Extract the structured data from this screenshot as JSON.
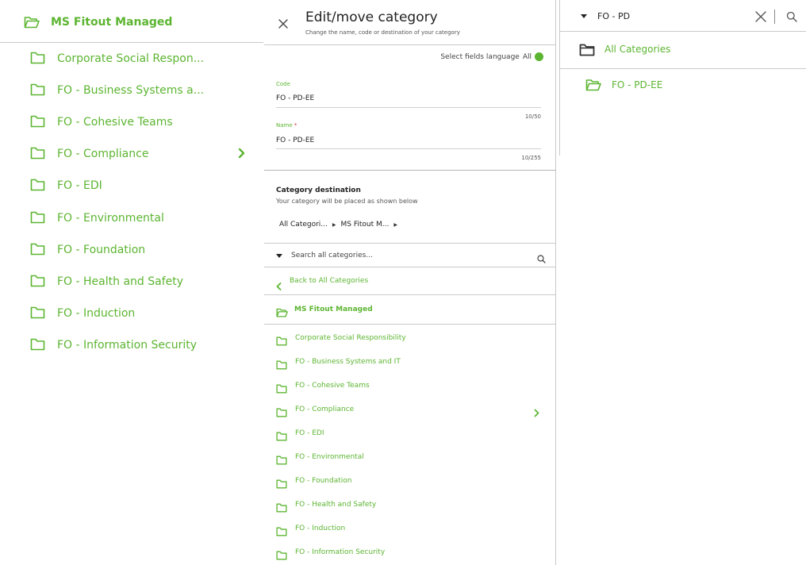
{
  "left_panel": {
    "header": {
      "title": "MS Fitout Managed",
      "icon": "folder-open-icon"
    },
    "items": [
      {
        "label": "Corporate Social Respon...",
        "icon": "folder-icon",
        "has_children": false
      },
      {
        "label": "FO - Business Systems a...",
        "icon": "folder-icon",
        "has_children": false
      },
      {
        "label": "FO - Cohesive Teams",
        "icon": "folder-icon",
        "has_children": false
      },
      {
        "label": "FO - Compliance",
        "icon": "folder-icon",
        "has_children": true
      },
      {
        "label": "FO - EDI",
        "icon": "folder-icon",
        "has_children": false
      },
      {
        "label": "FO - Environmental",
        "icon": "folder-icon",
        "has_children": false
      },
      {
        "label": "FO - Foundation",
        "icon": "folder-icon",
        "has_children": false
      },
      {
        "label": "FO - Health and Safety",
        "icon": "folder-icon",
        "has_children": false
      },
      {
        "label": "FO - Induction",
        "icon": "folder-icon",
        "has_children": false
      },
      {
        "label": "FO - Information Security",
        "icon": "folder-icon",
        "has_children": false
      }
    ]
  },
  "edit_panel": {
    "title": "Edit/move category",
    "subtitle": "Change the name, code or destination of your category",
    "language": {
      "label": "Select fields language",
      "value": "All"
    },
    "code_field": {
      "label": "Code",
      "value": "FO - PD-EE",
      "counter": "10/50"
    },
    "name_field": {
      "label": "Name",
      "required_mark": "*",
      "value": "FO - PD-EE",
      "counter": "10/255"
    },
    "destination": {
      "title": "Category destination",
      "subtitle": "Your category will be placed as shown below",
      "breadcrumb": [
        "All Categori...",
        "MS Fitout M..."
      ]
    },
    "category_search": {
      "placeholder": "Search all categories...",
      "value": ""
    },
    "back_label": "Back to All Categories",
    "group": {
      "label": "MS Fitout Managed",
      "icon": "folder-open-icon"
    },
    "items": [
      {
        "label": "Corporate Social Responsibility",
        "has_children": false
      },
      {
        "label": "FO - Business Systems and IT",
        "has_children": false
      },
      {
        "label": "FO - Cohesive Teams",
        "has_children": false
      },
      {
        "label": "FO - Compliance",
        "has_children": true
      },
      {
        "label": "FO - EDI",
        "has_children": false
      },
      {
        "label": "FO - Environmental",
        "has_children": false
      },
      {
        "label": "FO - Foundation",
        "has_children": false
      },
      {
        "label": "FO - Health and Safety",
        "has_children": false
      },
      {
        "label": "FO - Induction",
        "has_children": false
      },
      {
        "label": "FO - Information Security",
        "has_children": false
      }
    ]
  },
  "right_panel": {
    "search": {
      "value": "FO - PD"
    },
    "all_categories_label": "All Categories",
    "result": {
      "label": "FO - PD-EE",
      "icon": "folder-open-icon"
    }
  },
  "colors": {
    "accent": "#5cb531",
    "divider": "#c9c9c9",
    "text": "#222222",
    "required": "#dd3333"
  }
}
